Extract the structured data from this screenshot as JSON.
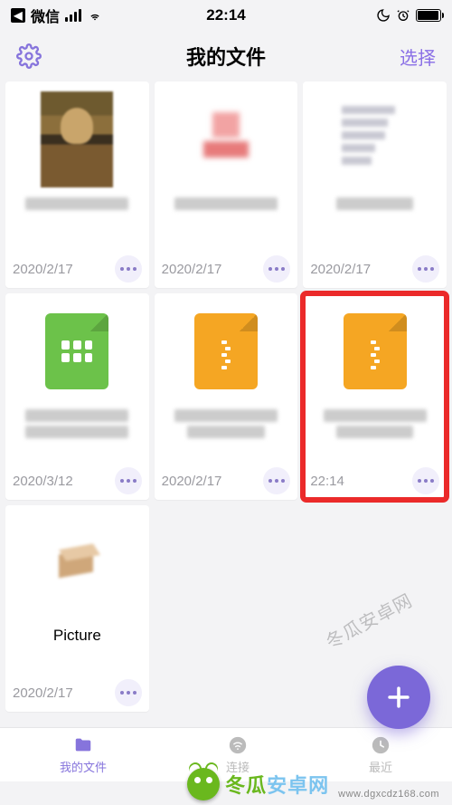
{
  "status_bar": {
    "app_name": "微信",
    "time": "22:14"
  },
  "nav": {
    "title": "我的文件",
    "select_label": "选择"
  },
  "files": [
    {
      "date": "2020/2/17"
    },
    {
      "date": "2020/2/17"
    },
    {
      "date": "2020/2/17"
    },
    {
      "date": "2020/3/12"
    },
    {
      "date": "2020/2/17"
    },
    {
      "date": "22:14"
    },
    {
      "name": "Picture",
      "date": "2020/2/17"
    }
  ],
  "tabs": {
    "files": "我的文件",
    "connect": "连接",
    "recent": "最近"
  },
  "watermark": {
    "brand_main": "冬瓜安卓网",
    "domain": "www.dgxcdz168.com",
    "diagonal": "冬瓜安卓网"
  },
  "colors": {
    "accent": "#8674dc",
    "fab": "#7b68d8",
    "highlight": "#eb2a2a",
    "green": "#6cc24a",
    "orange": "#f5a623"
  }
}
